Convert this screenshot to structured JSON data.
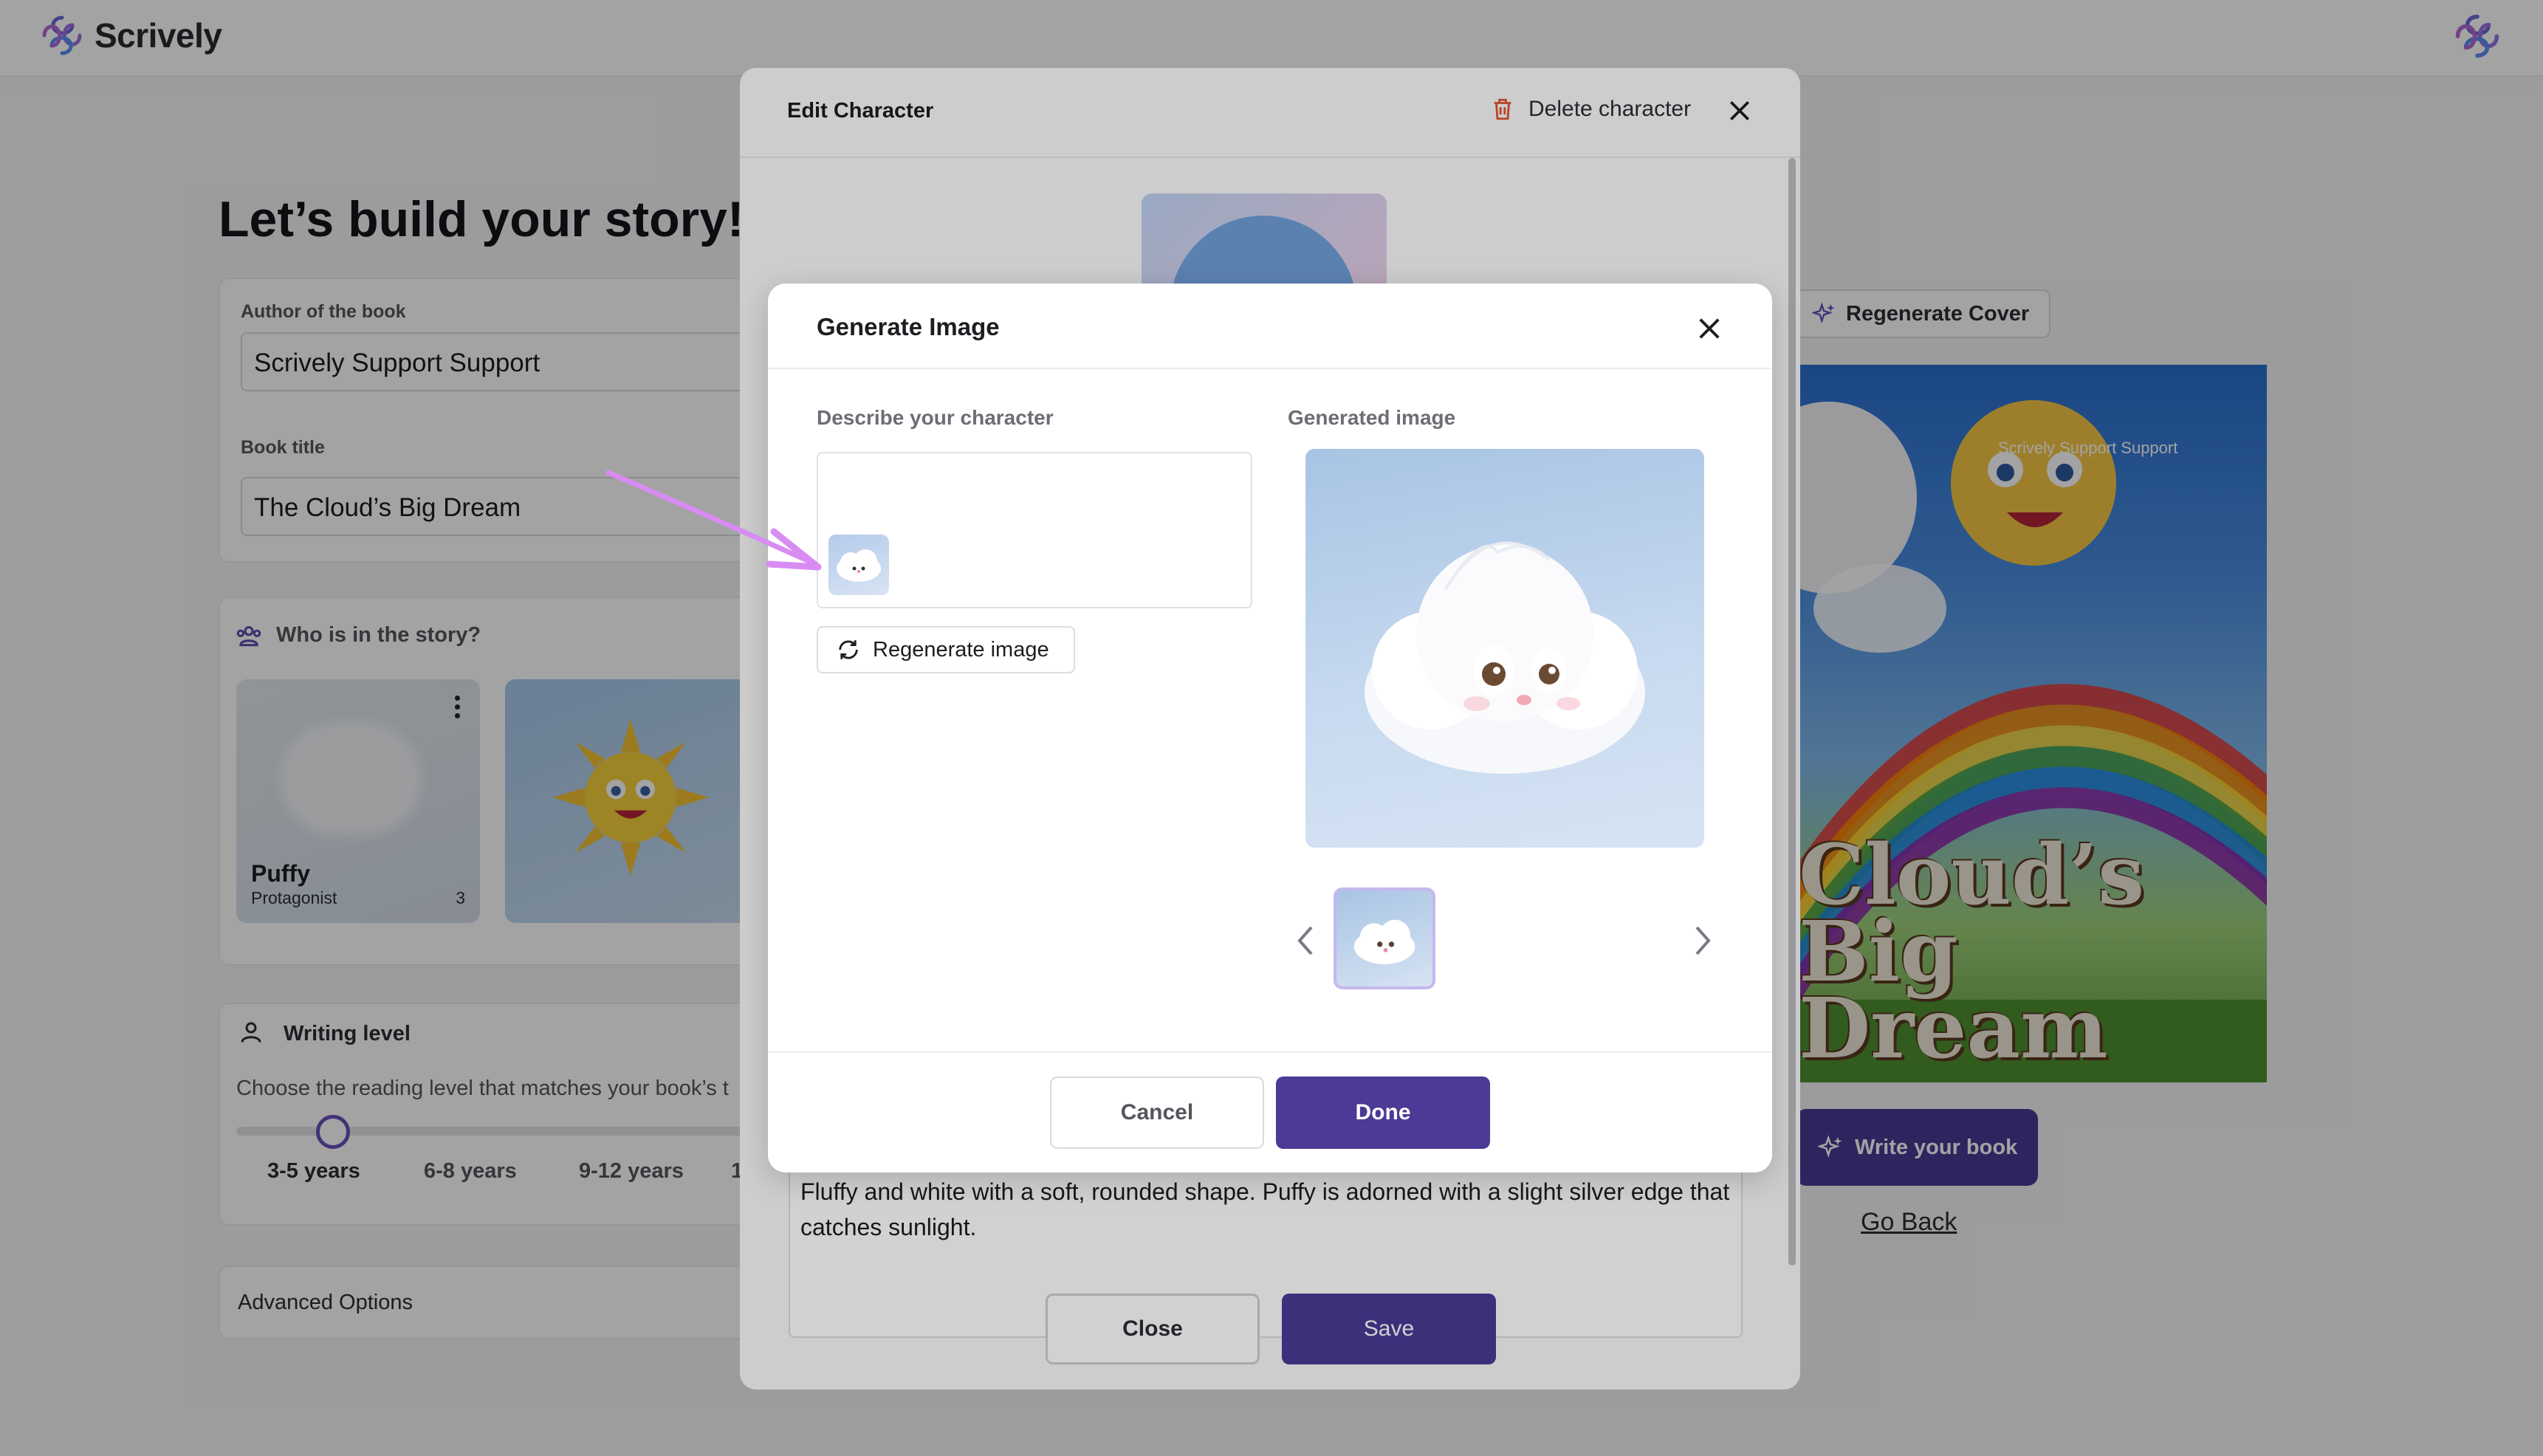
{
  "app": {
    "name": "Scrively"
  },
  "page": {
    "title": "Let’s build your story!"
  },
  "form": {
    "author_label": "Author of the book",
    "author_value": "Scrively Support Support",
    "book_title_label": "Book title",
    "book_title_value": "The Cloud’s Big Dream"
  },
  "characters_section": {
    "title": "Who is in the story?",
    "items": [
      {
        "name": "Puffy",
        "role": "Protagonist",
        "count": "3"
      }
    ]
  },
  "writing_level": {
    "title": "Writing level",
    "hint": "Choose the reading level that matches your book’s t",
    "levels": [
      "3-5 years",
      "6-8 years",
      "9-12 years",
      "1"
    ],
    "selected": "3-5 years"
  },
  "advanced_options": {
    "label": "Advanced Options"
  },
  "cover": {
    "regenerate_label": "Regenerate Cover",
    "title_line1": "Cloud’s Big",
    "title_line2": "Dream",
    "author_on_cover": "Scrively Support Support",
    "write_button": "Write your book",
    "go_back": "Go Back"
  },
  "edit_modal": {
    "title": "Edit Character",
    "delete_label": "Delete character",
    "description": "Fluffy and white with a soft, rounded shape. Puffy is adorned with a slight silver edge that catches sunlight.",
    "close_label": "Close",
    "save_label": "Save"
  },
  "generate_modal": {
    "title": "Generate Image",
    "describe_label": "Describe your character",
    "generated_label": "Generated image",
    "regenerate_label": "Regenerate image",
    "cancel_label": "Cancel",
    "done_label": "Done"
  },
  "colors": {
    "accent": "#4c3a96",
    "accent_light": "#c7b7ec",
    "annotation_arrow": "#d07ff0"
  }
}
